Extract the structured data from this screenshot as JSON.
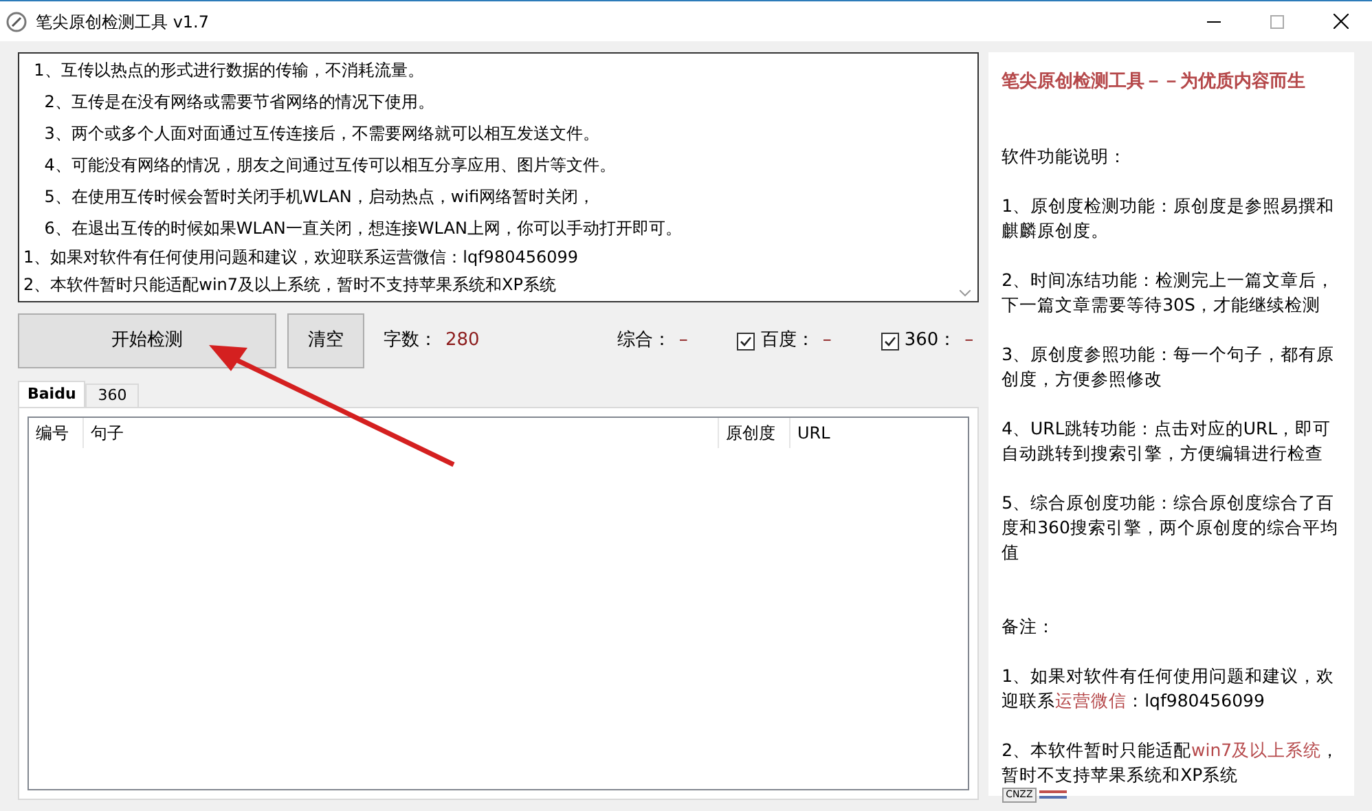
{
  "window": {
    "title": "笔尖原创检测工具 v1.7"
  },
  "text_area": {
    "lines": [
      {
        "kind": "tip",
        "text": "  1、互传以热点的形式进行数据的传输，不消耗流量。"
      },
      {
        "kind": "tip",
        "text": "    2、互传是在没有网络或需要节省网络的情况下使用。"
      },
      {
        "kind": "tip",
        "text": "    3、两个或多个人面对面通过互传连接后，不需要网络就可以相互发送文件。"
      },
      {
        "kind": "tip",
        "text": "    4、可能没有网络的情况，朋友之间通过互传可以相互分享应用、图片等文件。"
      },
      {
        "kind": "tip",
        "text": "    5、在使用互传时候会暂时关闭手机WLAN，启动热点，wifi网络暂时关闭，"
      },
      {
        "kind": "tip",
        "text": "    6、在退出互传的时候如果WLAN一直关闭，想连接WLAN上网，你可以手动打开即可。"
      },
      {
        "kind": "note",
        "text": "1、如果对软件有任何使用问题和建议，欢迎联系运营微信：lqf980456099"
      },
      {
        "kind": "note",
        "text": "2、本软件暂时只能适配win7及以上系统，暂时不支持苹果系统和XP系统"
      }
    ]
  },
  "buttons": [
    "开始检测",
    "清空"
  ],
  "stats": [
    {
      "kind": "plain",
      "label": "字数：",
      "value": "280"
    },
    {
      "kind": "plain",
      "label": "综合：",
      "value": "–"
    },
    {
      "kind": "check",
      "checked": true,
      "label": "百度：",
      "value": "–"
    },
    {
      "kind": "check",
      "checked": true,
      "label": "360：",
      "value": "–"
    }
  ],
  "tabs": [
    {
      "label": "Baidu",
      "selected": true
    },
    {
      "label": "360",
      "selected": false
    }
  ],
  "table": {
    "columns": [
      "编号",
      "句子",
      "原创度",
      "URL"
    ]
  },
  "info_panel": {
    "heading": "笔尖原创检测工具－－为优质内容而生",
    "paragraphs": [
      {
        "kind": "gap",
        "text": "软件功能说明："
      },
      "1、原创度检测功能：原创度是参照易撰和麒麟原创度。",
      "2、时间冻结功能：检测完上一篇文章后，下一篇文章需要等待30S，才能继续检测",
      "3、原创度参照功能：每一个句子，都有原创度，方便参照修改",
      "4、URL跳转功能：点击对应的URL，即可自动跳转到搜索引擎，方便编辑进行检查",
      "5、综合原创度功能：综合原创度综合了百度和360搜索引擎，两个原创度的综合平均值",
      {
        "kind": "gap",
        "text": "备注："
      },
      "1、如果对软件有任何使用问题和建议，欢迎联系**运营微信**：lqf980456099",
      "2、本软件暂时只能适配**win7及以上系统**，暂时不支持苹果系统和XP系统"
    ],
    "badge": "CNZZ"
  }
}
